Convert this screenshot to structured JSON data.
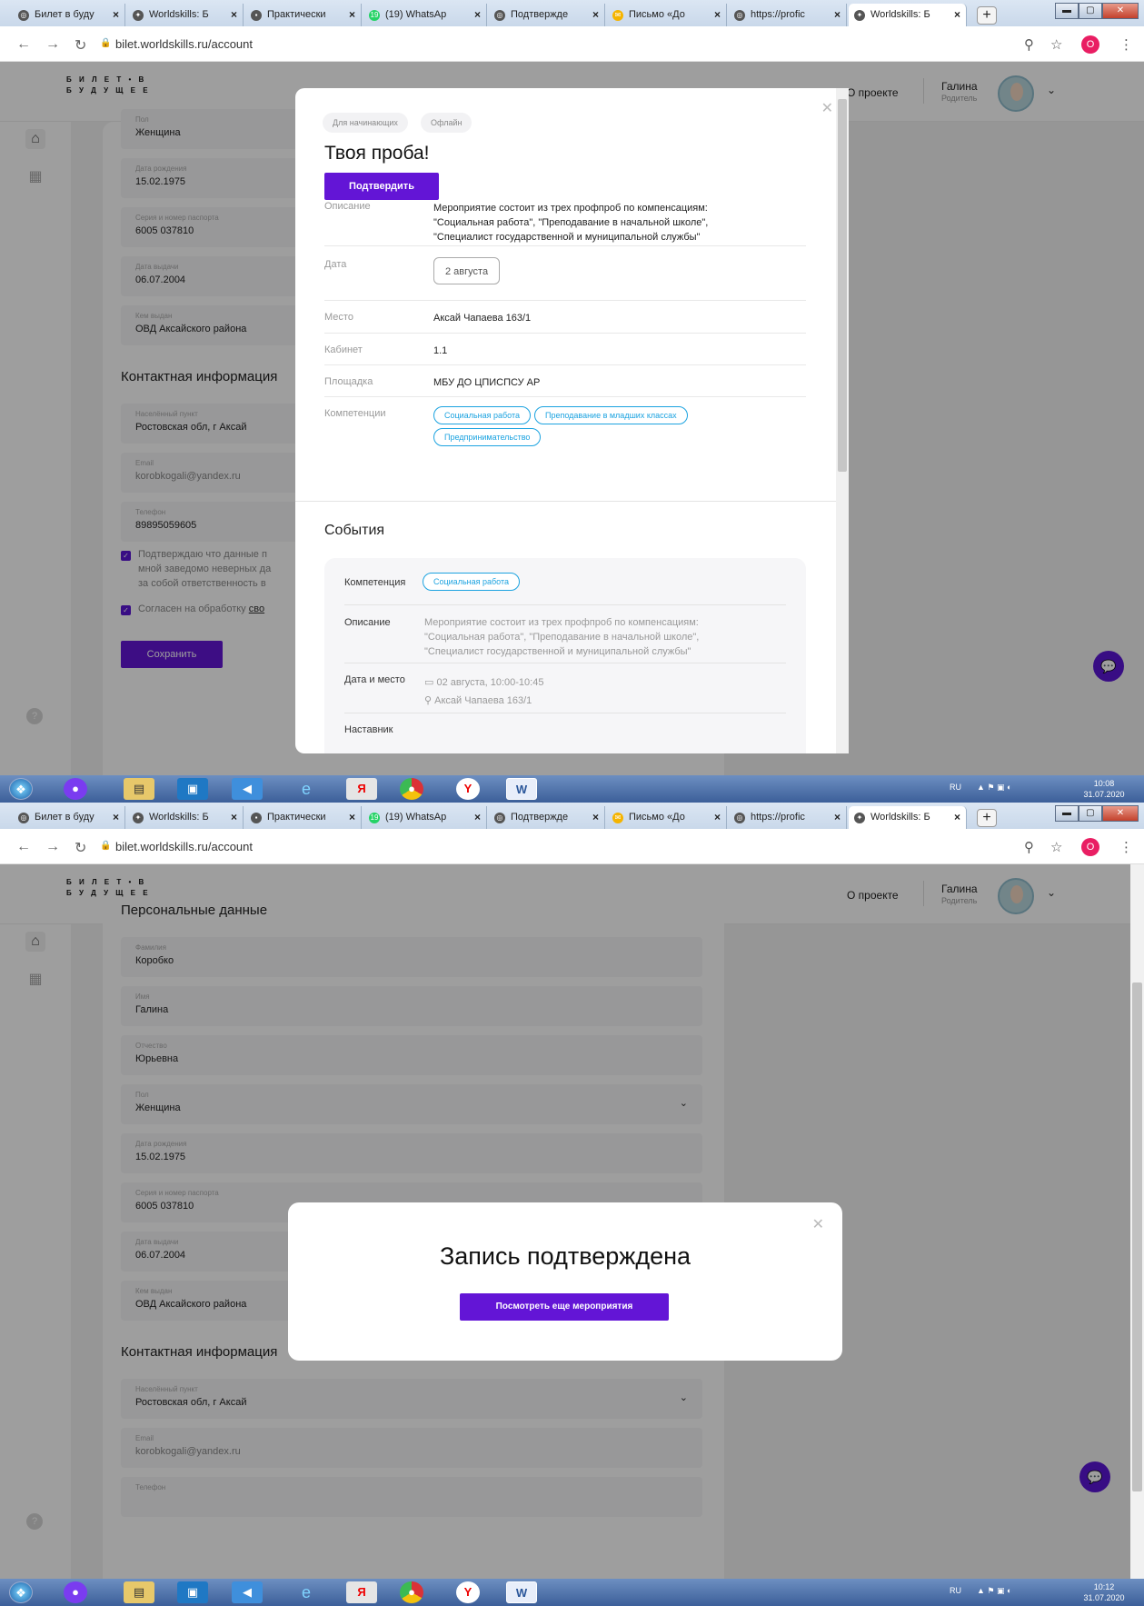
{
  "browser": {
    "tabs": [
      "Билет в буду",
      "Worldskills: Б",
      "Практически",
      "(19) WhatsAp",
      "Подтвержде",
      "Письмо «До",
      "https://profic",
      "Worldskills: Б"
    ],
    "tab_icons": [
      "globe",
      "worldskills",
      "doc",
      "whatsapp",
      "globe",
      "mail",
      "globe",
      "worldskills"
    ],
    "whatsapp_badge": "19",
    "url": "bilet.worldskills.ru/account",
    "profile_initial": "O"
  },
  "site": {
    "logo_line1": "Б И Л Е Т • В",
    "logo_line2": "Б У Д У Щ Е Е",
    "about": "О проекте",
    "user_name": "Галина",
    "user_role": "Родитель"
  },
  "form": {
    "personal_heading": "Персональные данные",
    "fields": [
      {
        "label": "Фамилия",
        "value": "Коробко"
      },
      {
        "label": "Имя",
        "value": "Галина"
      },
      {
        "label": "Отчество",
        "value": "Юрьевна"
      },
      {
        "label": "Пол",
        "value": "Женщина"
      },
      {
        "label": "Дата рождения",
        "value": "15.02.1975"
      },
      {
        "label": "Серия и номер паспорта",
        "value": "6005 037810"
      },
      {
        "label": "Дата выдачи",
        "value": "06.07.2004"
      },
      {
        "label": "Кем выдан",
        "value": "ОВД Аксайского района"
      }
    ],
    "contact_heading": "Контактная информация",
    "contact_fields": [
      {
        "label": "Населённый пункт",
        "value": "Ростовская обл, г Аксай"
      },
      {
        "label": "Email",
        "value": "korobkogali@yandex.ru"
      },
      {
        "label": "Телефон",
        "value": "89895059605"
      }
    ],
    "confirm_line1": "Подтверждаю что данные п",
    "confirm_line2": "мной заведомо неверных да",
    "confirm_line3": "за собой ответственность в",
    "agree_text": "Согласен на обработку ",
    "agree_link": "сво",
    "save": "Сохранить"
  },
  "modal1": {
    "tags": [
      "Для начинающих",
      "Офлайн"
    ],
    "title": "Твоя проба!",
    "confirm": "Подтвердить",
    "desc_label": "Описание",
    "desc_lines": [
      "Мероприятие состоит из трех профпроб по компенсациям:",
      "\"Социальная работа\", \"Преподавание в начальной школе\",",
      "\"Специалист государственной и муниципальной службы\""
    ],
    "date_label": "Дата",
    "date": "2 августа",
    "place_label": "Место",
    "place": "Аксай Чапаева 163/1",
    "room_label": "Кабинет",
    "room": "1.1",
    "venue_label": "Площадка",
    "venue": "МБУ ДО ЦПИСПСУ АР",
    "comp_label": "Компетенции",
    "competencies": [
      "Социальная работа",
      "Преподавание в младших классах",
      "Предпринимательство"
    ],
    "events_heading": "События",
    "ev_comp_label": "Компетенция",
    "ev_comp": "Социальная работа",
    "ev_desc_label": "Описание",
    "ev_desc_lines": [
      "Мероприятие состоит из трех профпроб по компенсациям:",
      "\"Социальная работа\", \"Преподавание в начальной школе\",",
      "\"Специалист государственной и муниципальной службы\""
    ],
    "ev_dp_label": "Дата и место",
    "ev_date": "02 августа, 10:00-10:45",
    "ev_place": "Аксай Чапаева 163/1",
    "ev_mentor_label": "Наставник"
  },
  "modal2": {
    "title": "Запись подтверждена",
    "button": "Посмотреть еще мероприятия"
  },
  "taskbar": {
    "lang": "RU",
    "time1": "10:08",
    "time2": "10:12",
    "date": "31.07.2020"
  }
}
